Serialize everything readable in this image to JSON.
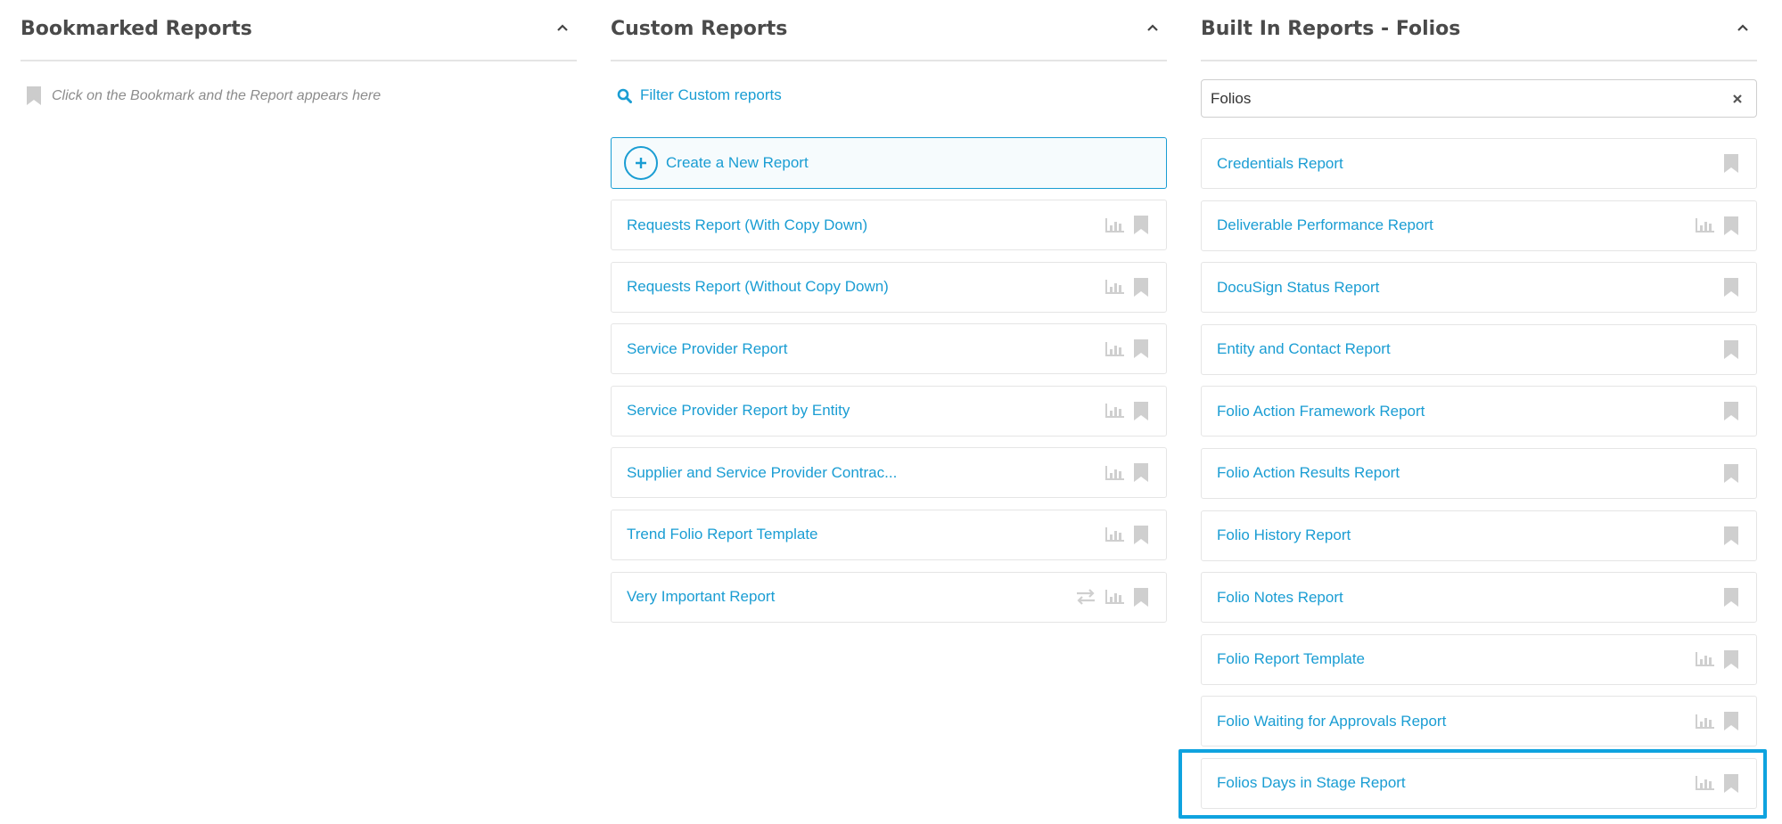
{
  "bookmarked": {
    "title": "Bookmarked Reports",
    "empty_hint": "Click on the Bookmark and the Report appears here"
  },
  "custom": {
    "title": "Custom Reports",
    "filter_link": "Filter Custom reports",
    "create_label": "Create a New Report",
    "items": [
      {
        "label": "Requests Report (With Copy Down)"
      },
      {
        "label": "Requests Report (Without Copy Down)"
      },
      {
        "label": "Service Provider Report"
      },
      {
        "label": "Service Provider Report by Entity"
      },
      {
        "label": "Supplier and Service Provider Contrac..."
      },
      {
        "label": "Trend Folio Report Template"
      },
      {
        "label": "Very Important Report"
      }
    ]
  },
  "builtin": {
    "title": "Built In Reports - Folios",
    "search_value": "Folios",
    "items": [
      {
        "label": "Credentials Report"
      },
      {
        "label": "Deliverable Performance Report"
      },
      {
        "label": "DocuSign Status Report"
      },
      {
        "label": "Entity and Contact Report"
      },
      {
        "label": "Folio Action Framework Report"
      },
      {
        "label": "Folio Action Results Report"
      },
      {
        "label": "Folio History Report"
      },
      {
        "label": "Folio Notes Report"
      },
      {
        "label": "Folio Report Template"
      },
      {
        "label": "Folio Waiting for Approvals Report"
      },
      {
        "label": "Folios Days in Stage Report"
      }
    ]
  },
  "colors": {
    "accent": "#1a9dd3",
    "highlight": "#0fa3df",
    "icon_gray": "#cfcfcf",
    "title_gray": "#4a4a4a"
  },
  "icons": [
    "chevron-up-icon",
    "bookmark-icon",
    "search-icon",
    "plus-icon",
    "chart-icon",
    "swap-icon",
    "close-icon"
  ]
}
